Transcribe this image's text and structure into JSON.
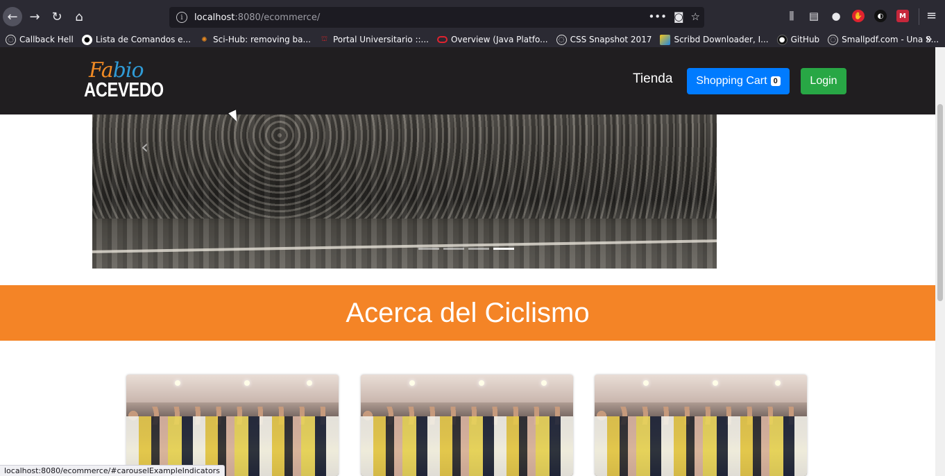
{
  "browser": {
    "url_host": "localhost",
    "url_path": ":8080/ecommerce/",
    "bookmarks": [
      {
        "label": "Callback Hell",
        "icon": "globe-icon"
      },
      {
        "label": "Lista de Comandos e...",
        "icon": "github-icon"
      },
      {
        "label": "Sci-Hub: removing ba...",
        "icon": "scihub-icon"
      },
      {
        "label": "Portal Universitario ::...",
        "icon": "university-icon"
      },
      {
        "label": "Overview (Java Platfo...",
        "icon": "oracle-icon"
      },
      {
        "label": "CSS Snapshot 2017",
        "icon": "globe-icon"
      },
      {
        "label": "Scribd Downloader, I...",
        "icon": "scribd-icon"
      },
      {
        "label": "GitHub",
        "icon": "github-icon"
      },
      {
        "label": "Smallpdf.com - Una S...",
        "icon": "globe-icon"
      }
    ],
    "status_text": "localhost:8080/ecommerce/#carouselExampleIndicators"
  },
  "site": {
    "logo_fa": "Fa",
    "logo_bio": "bio",
    "logo_acevedo": "ACEVEDO",
    "nav_tienda": "Tienda",
    "cart_label": "Shopping Cart",
    "cart_count": "0",
    "login_label": "Login"
  },
  "carousel": {
    "indicator_count": 4,
    "active_index": 3
  },
  "about": {
    "title": "Acerca del Ciclismo"
  },
  "colors": {
    "nav_bg": "#201e20",
    "about_bg": "#f48426",
    "cart_btn": "#007bff",
    "login_btn": "#28a745"
  }
}
